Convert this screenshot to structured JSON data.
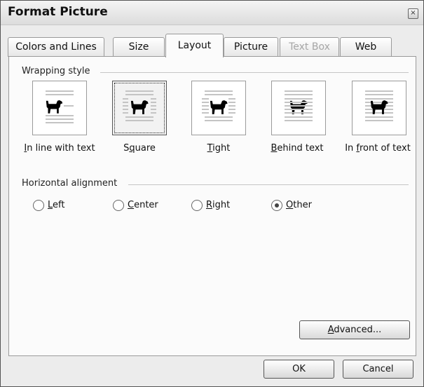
{
  "window": {
    "title": "Format Picture",
    "close_glyph": "×"
  },
  "tabs": [
    {
      "label": "Colors and Lines",
      "state": "normal"
    },
    {
      "label": "Size",
      "state": "normal"
    },
    {
      "label": "Layout",
      "state": "active"
    },
    {
      "label": "Picture",
      "state": "normal"
    },
    {
      "label": "Text Box",
      "state": "disabled"
    },
    {
      "label": "Web",
      "state": "normal"
    }
  ],
  "wrapping": {
    "label": "Wrapping style",
    "options": [
      {
        "key": "I",
        "rest": "n line with text",
        "selected": false,
        "icon": "in-line-wrap-icon"
      },
      {
        "pre": "S",
        "key": "q",
        "rest": "uare",
        "selected": true,
        "icon": "square-wrap-icon"
      },
      {
        "key": "T",
        "rest": "ight",
        "selected": false,
        "icon": "tight-wrap-icon"
      },
      {
        "key": "B",
        "rest": "ehind text",
        "selected": false,
        "icon": "behind-text-icon"
      },
      {
        "pre": "In ",
        "key": "f",
        "rest": "ront of text",
        "selected": false,
        "icon": "in-front-of-text-icon"
      }
    ]
  },
  "alignment": {
    "label": "Horizontal alignment",
    "options": [
      {
        "key": "L",
        "rest": "eft",
        "checked": false
      },
      {
        "key": "C",
        "rest": "enter",
        "checked": false
      },
      {
        "key": "R",
        "rest": "ight",
        "checked": false
      },
      {
        "key": "O",
        "rest": "ther",
        "checked": true
      }
    ]
  },
  "buttons": {
    "advanced": {
      "key": "A",
      "rest": "dvanced..."
    },
    "ok": "OK",
    "cancel": "Cancel"
  },
  "colors": {
    "dialog_bg": "#ececec",
    "panel_bg": "#fbfbfb",
    "text_lines": "#c4c4c4",
    "dog": "#000000"
  }
}
